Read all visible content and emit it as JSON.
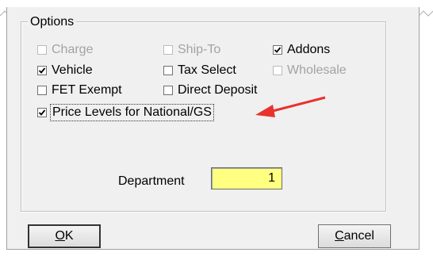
{
  "options_group": {
    "title": "Options",
    "items": [
      {
        "label": "Charge",
        "checked": false,
        "enabled": false
      },
      {
        "label": "Ship-To",
        "checked": false,
        "enabled": false
      },
      {
        "label": "Addons",
        "checked": true,
        "enabled": true
      },
      {
        "label": "Vehicle",
        "checked": true,
        "enabled": true
      },
      {
        "label": "Tax Select",
        "checked": false,
        "enabled": true
      },
      {
        "label": "Wholesale",
        "checked": false,
        "enabled": false
      },
      {
        "label": "FET Exempt",
        "checked": false,
        "enabled": true
      },
      {
        "label": "Direct Deposit",
        "checked": false,
        "enabled": true
      },
      {
        "label": "Price Levels for National/GS",
        "checked": true,
        "enabled": true
      }
    ]
  },
  "department": {
    "label": "Department",
    "value": "1",
    "field_color": "#ffff80"
  },
  "buttons": {
    "ok": {
      "mnemonic": "O",
      "rest": "K"
    },
    "cancel": {
      "mnemonic": "C",
      "rest": "ancel"
    }
  },
  "annotation": {
    "arrow_color": "#e8322d"
  }
}
